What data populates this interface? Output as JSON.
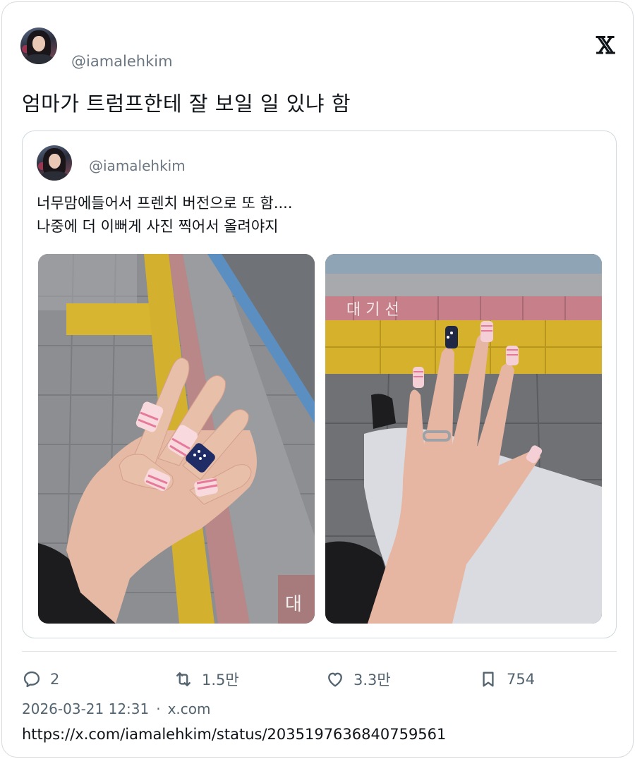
{
  "post": {
    "handle": "@iamalehkim",
    "brand_logo": "𝕏",
    "text": "엄마가 트럼프한테 잘 보일 일 있냐 함",
    "quote": {
      "handle": "@iamalehkim",
      "text_line1": "너무맘에들어서 프렌치 버전으로 또 함....",
      "text_line2": "나중에 더 이뻐게 사진 찍어서 올려야지",
      "photos": [
        {
          "icon": "photo-nails-left-hand",
          "overlay_text": "대"
        },
        {
          "icon": "photo-nails-right-hand",
          "overlay_text": "대 기 선"
        }
      ]
    },
    "stats": {
      "replies": "2",
      "retweets": "1.5만",
      "likes": "3.3만",
      "bookmarks": "754"
    },
    "meta": {
      "datetime": "2026-03-21 12:31",
      "separator": "·",
      "source": "x.com"
    },
    "url": "https://x.com/iamalehkim/status/2035197636840759561"
  },
  "colors": {
    "text_primary": "#0f1419",
    "text_secondary": "#536471",
    "border": "#cfd9de"
  }
}
